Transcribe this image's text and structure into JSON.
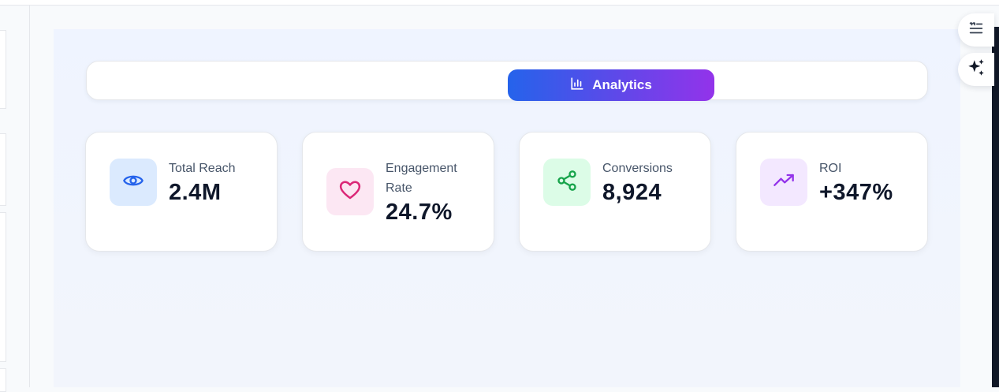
{
  "tabs": {
    "active_label": "Analytics"
  },
  "stats": [
    {
      "label": "Total Reach",
      "value": "2.4M",
      "icon": "eye-icon",
      "color": "#2563eb",
      "bg": "#dbeafe"
    },
    {
      "label": "Engagement Rate",
      "value": "24.7%",
      "icon": "heart-icon",
      "color": "#db2777",
      "bg": "#fce7f3"
    },
    {
      "label": "Conversions",
      "value": "8,924",
      "icon": "share-icon",
      "color": "#16a34a",
      "bg": "#dcfce7"
    },
    {
      "label": "ROI",
      "value": "+347%",
      "icon": "trending-up-icon",
      "color": "#9333ea",
      "bg": "#f3e8ff"
    }
  ],
  "floating_actions": [
    {
      "icon": "notes-icon"
    },
    {
      "icon": "sparkles-icon"
    }
  ],
  "colors": {
    "accent_start": "#2563eb",
    "accent_end": "#9333ea"
  }
}
